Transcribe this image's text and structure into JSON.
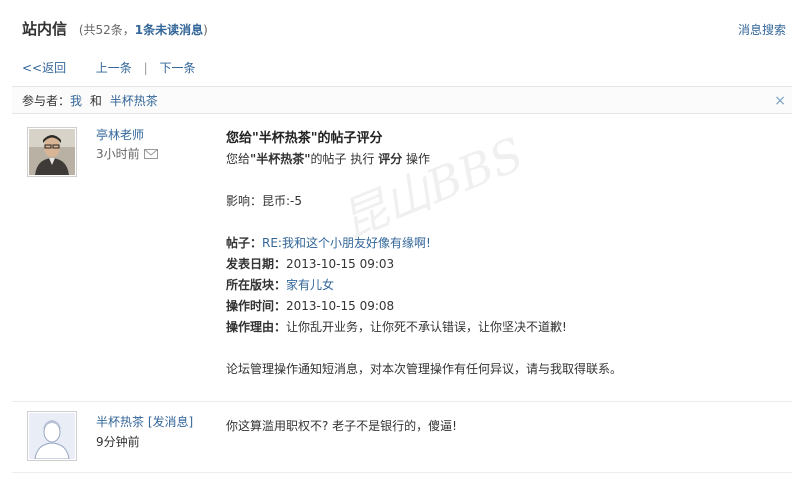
{
  "header": {
    "title": "站内信",
    "count_prefix": "(共52条，",
    "unread": "1条未读消息",
    "count_suffix": ")",
    "search_link": "消息搜索"
  },
  "nav": {
    "back": "<<返回",
    "prev": "上一条",
    "sep": "|",
    "next": "下一条"
  },
  "participants": {
    "label": "参与者：",
    "me": "我",
    "and": "和",
    "other": "半杯热茶",
    "close": "×"
  },
  "messages": [
    {
      "author": "亭林老师",
      "time": "3小时前",
      "subject": "您给\"半杯热茶\"的帖子评分",
      "line1_prefix": "您给",
      "line1_name": "\"半杯热茶\"",
      "line1_mid": "的帖子 执行",
      "line1_action": "评分",
      "line1_suffix": "操作",
      "influence": "影响：昆币:-5",
      "post_label": "帖子：",
      "post_link": "RE:我和这个小朋友好像有缘啊!",
      "date_label": "发表日期：",
      "date_value": "2013-10-15 09:03",
      "board_label": "所在版块：",
      "board_link": "家有儿女",
      "optime_label": "操作时间：",
      "optime_value": "2013-10-15 09:08",
      "reason_label": "操作理由：",
      "reason_value": "让你乱开业务，让你死不承认错误，让你坚决不道歉!",
      "footer": "论坛管理操作通知短消息，对本次管理操作有任何异议，请与我取得联系。"
    },
    {
      "author": "半杯热茶",
      "send_link": "[发消息]",
      "time": "9分钟前",
      "text": "你这算滥用职权不? 老子不是银行的，傻逼!"
    }
  ],
  "watermark": "昆山BBS"
}
